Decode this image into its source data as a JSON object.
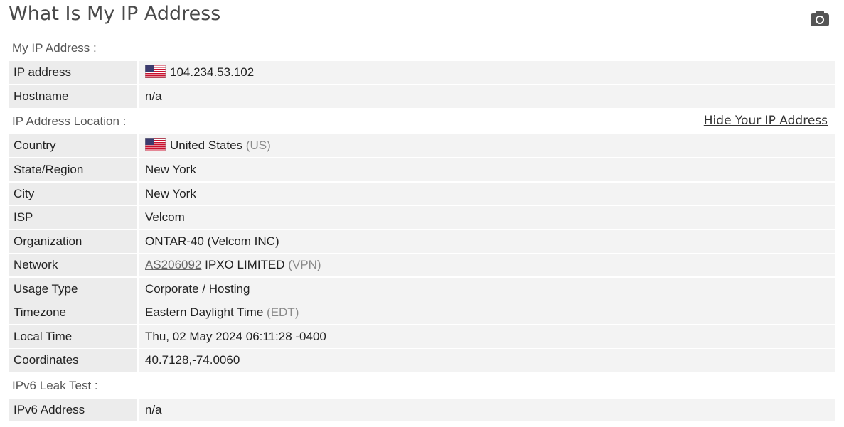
{
  "title": "What Is My IP Address",
  "camera_icon": "camera-icon",
  "sections": {
    "ip": "My IP Address :",
    "location": "IP Address Location :",
    "ipv6": "IPv6 Leak Test :"
  },
  "hide_link": "Hide Your IP Address",
  "ip_rows": {
    "ip_address": {
      "label": "IP address",
      "value": "104.234.53.102",
      "flag": "us-flag-icon"
    },
    "hostname": {
      "label": "Hostname",
      "value": "n/a"
    }
  },
  "location_rows": {
    "country": {
      "label": "Country",
      "value": "United States",
      "code": "(US)",
      "flag": "us-flag-icon"
    },
    "state": {
      "label": "State/Region",
      "value": "New York"
    },
    "city": {
      "label": "City",
      "value": "New York"
    },
    "isp": {
      "label": "ISP",
      "value": "Velcom"
    },
    "organization": {
      "label": "Organization",
      "value": "ONTAR-40 (Velcom INC)"
    },
    "network": {
      "label": "Network",
      "asn": "AS206092",
      "value": "IPXO LIMITED",
      "tag": "(VPN)"
    },
    "usage_type": {
      "label": "Usage Type",
      "value": "Corporate / Hosting"
    },
    "timezone": {
      "label": "Timezone",
      "value": "Eastern Daylight Time",
      "tag": "(EDT)"
    },
    "local_time": {
      "label": "Local Time",
      "value": "Thu, 02 May 2024 06:11:28 -0400"
    },
    "coordinates": {
      "label": "Coordinates",
      "value": "40.7128,-74.0060"
    }
  },
  "ipv6_rows": {
    "ipv6_address": {
      "label": "IPv6 Address",
      "value": "n/a"
    }
  },
  "colors": {
    "label_bg": "#ececec",
    "value_bg": "#f3f3f3",
    "title": "#4a4a4a",
    "muted": "#888888"
  }
}
